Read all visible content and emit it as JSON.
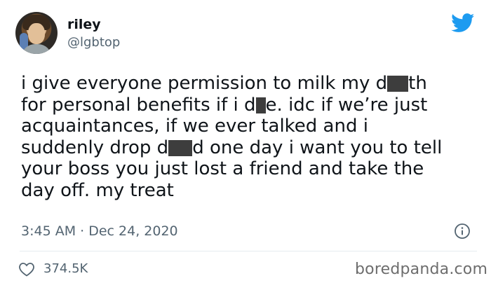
{
  "tweet": {
    "name": "riley",
    "handle": "@lgbtop",
    "lines": [
      {
        "a": "i give everyone permission to milk my d",
        "b": "th"
      },
      {
        "a": "for personal benefits if i d",
        "b": "e. idc if we’re just"
      },
      {
        "a": "acquaintances, if we ever talked and i"
      },
      {
        "a": "suddenly drop d",
        "b": "d one day i want you to tell"
      },
      {
        "a": "your boss you just lost a friend and take the"
      },
      {
        "a": "day off. my treat"
      }
    ],
    "timestamp": "3:45 AM · Dec 24, 2020",
    "likes": "374.5K"
  },
  "watermark": "boredpanda.com",
  "colors": {
    "twitter_blue": "#1d9bf0",
    "text": "#0f1419",
    "secondary": "#536471",
    "redaction": "#3d3d3d"
  },
  "icons": [
    "twitter-bird-icon",
    "info-icon",
    "heart-icon"
  ]
}
